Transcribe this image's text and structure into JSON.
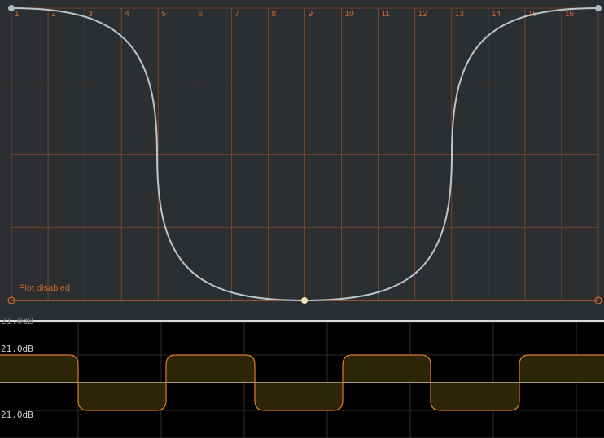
{
  "editor": {
    "columns": [
      "1",
      "2",
      "3",
      "4",
      "5",
      "6",
      "7",
      "8",
      "9",
      "10",
      "11",
      "12",
      "13",
      "14",
      "15",
      "16"
    ],
    "status_text": "Plot disabled",
    "colors": {
      "background": "#2b2f31",
      "grid": "#8a4a2a",
      "labels": "#d2692e",
      "curve": "#b9c6cc",
      "handle": "#aebdc4",
      "center_handle": "#f0e6b4",
      "baseline": "#d2692e"
    }
  },
  "scope": {
    "top_label": "21.0dB",
    "bottom_label": "21.0dB",
    "colors": {
      "background": "#000000",
      "grid": "#3a3a3a",
      "fill": "#2d2508",
      "wave": "#e07a2a",
      "zero_line": "#f0e6b4"
    }
  }
}
